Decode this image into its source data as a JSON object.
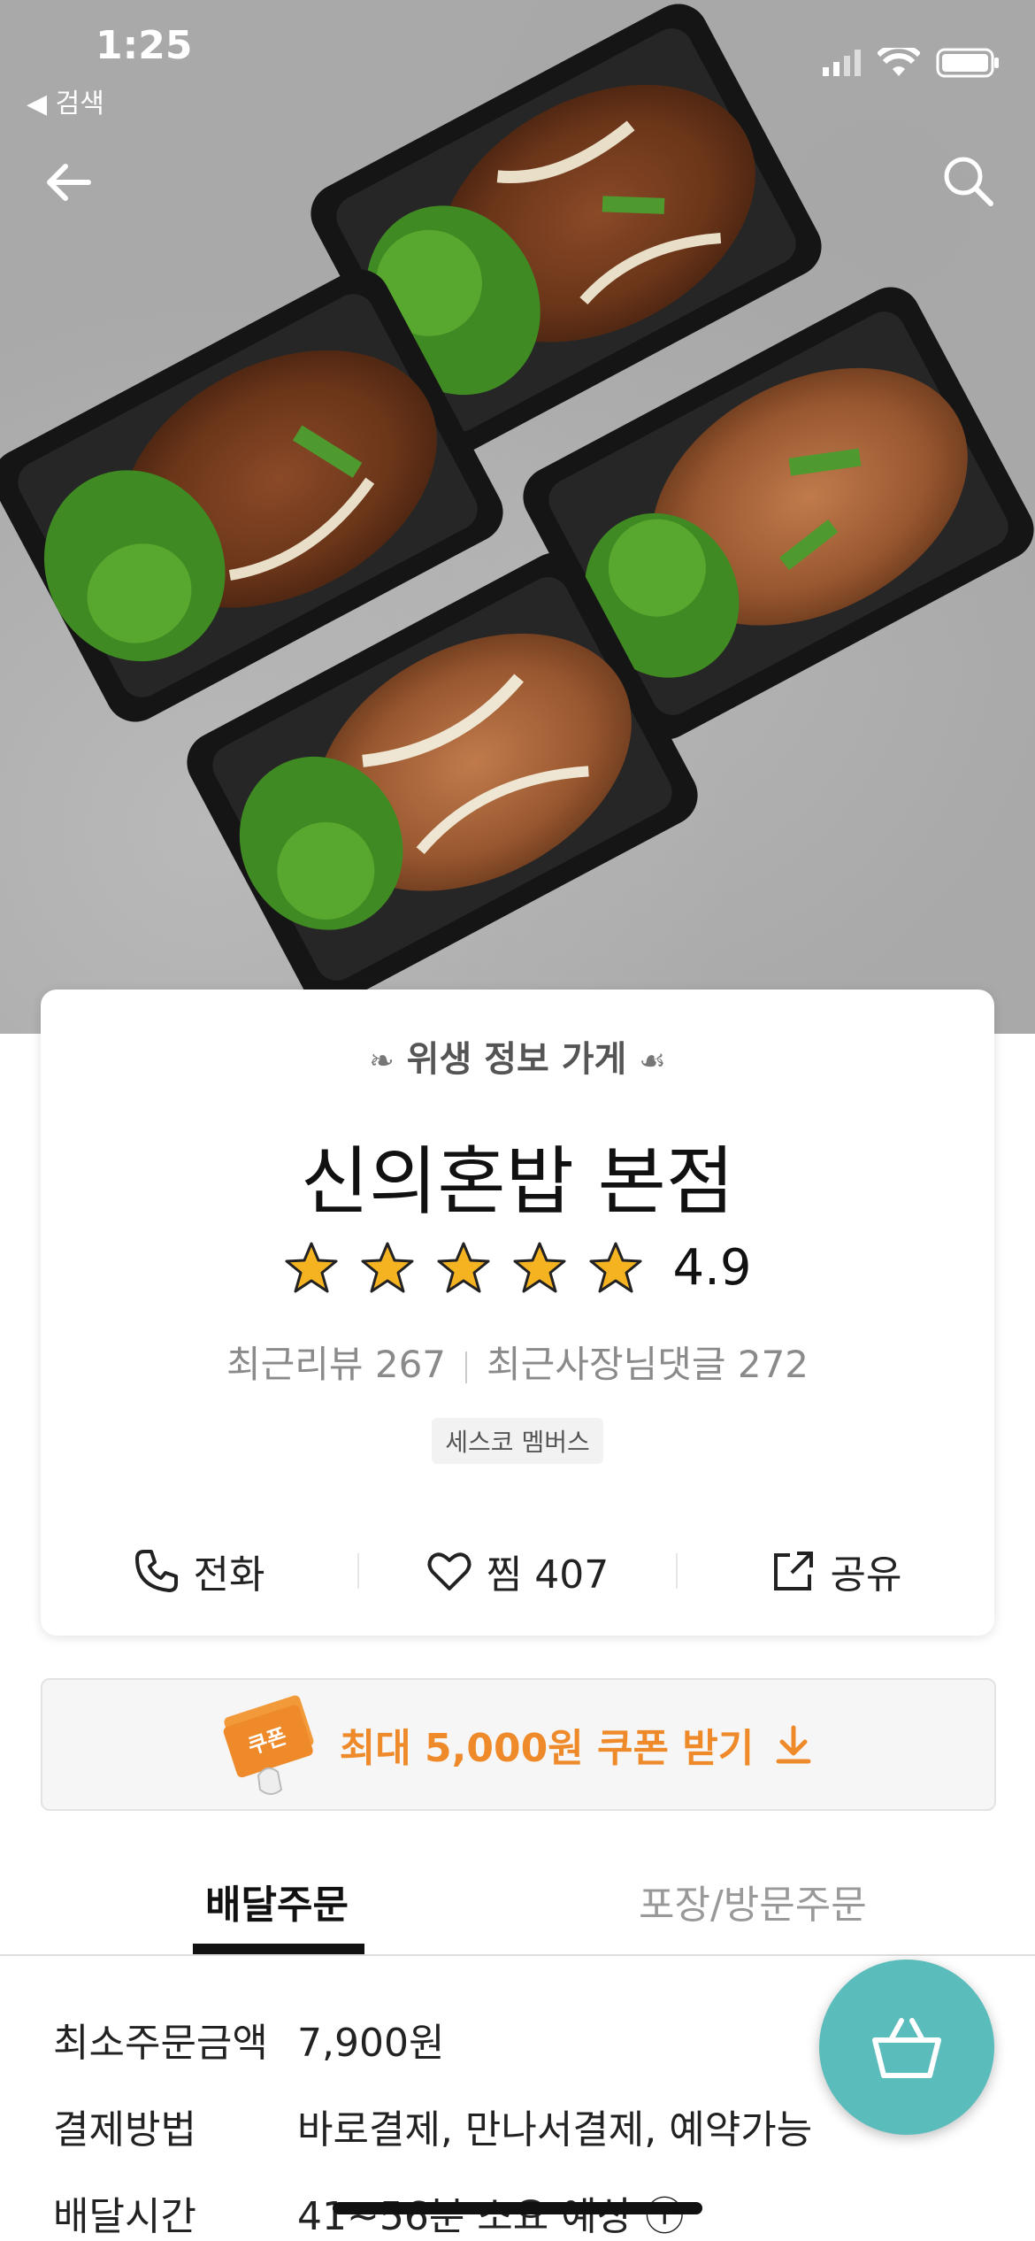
{
  "status_bar": {
    "time": "1:25",
    "back_app": "◀ 검색"
  },
  "store": {
    "hygiene_label": "위생 정보 가게",
    "name": "신의혼밥 본점",
    "rating": "4.9",
    "stars": 5,
    "recent_reviews": "최근리뷰 267",
    "owner_replies": "최근사장님댓글 272",
    "badge": "세스코 멤버스"
  },
  "actions": {
    "call_label": "전화",
    "favorite_label": "찜 407",
    "share_label": "공유"
  },
  "coupon": {
    "label": "최대 5,000원 쿠폰 받기",
    "stamp_text": "쿠폰"
  },
  "tabs": [
    {
      "label": "배달주문",
      "active": true
    },
    {
      "label": "포장/방문주문",
      "active": false
    }
  ],
  "info": {
    "min_order_label": "최소주문금액",
    "min_order_value": "7,900원",
    "payment_label": "결제방법",
    "payment_value": "바로결제, 만나서결제, 예약가능",
    "delivery_time_label": "배달시간",
    "delivery_time_value": "41~56분 소요 예상 ⓘ"
  },
  "colors": {
    "accent_orange": "#ee8a2a",
    "cart_teal": "#5bbcbc",
    "star_gold": "#f5b321"
  }
}
